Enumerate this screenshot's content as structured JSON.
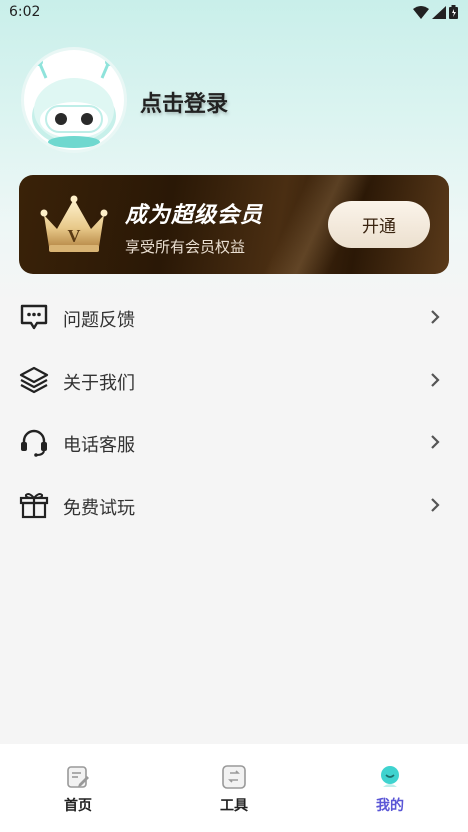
{
  "status_bar": {
    "time": "6:02"
  },
  "profile": {
    "login_text": "点击登录"
  },
  "vip": {
    "title": "成为超级会员",
    "subtitle": "享受所有会员权益",
    "button_label": "开通",
    "crown_letter": "V"
  },
  "menu": {
    "items": [
      {
        "label": "问题反馈",
        "icon": "message-icon"
      },
      {
        "label": "关于我们",
        "icon": "layers-icon"
      },
      {
        "label": "电话客服",
        "icon": "headset-icon"
      },
      {
        "label": "免费试玩",
        "icon": "gift-icon"
      }
    ]
  },
  "tabbar": {
    "tabs": [
      {
        "label": "首页",
        "icon": "home-edit-icon"
      },
      {
        "label": "工具",
        "icon": "tools-icon"
      },
      {
        "label": "我的",
        "icon": "mine-icon",
        "active": true
      }
    ]
  },
  "colors": {
    "accent": "#5a56d6",
    "vip_dark": "#2a1806",
    "teal": "#3fd3cf"
  }
}
